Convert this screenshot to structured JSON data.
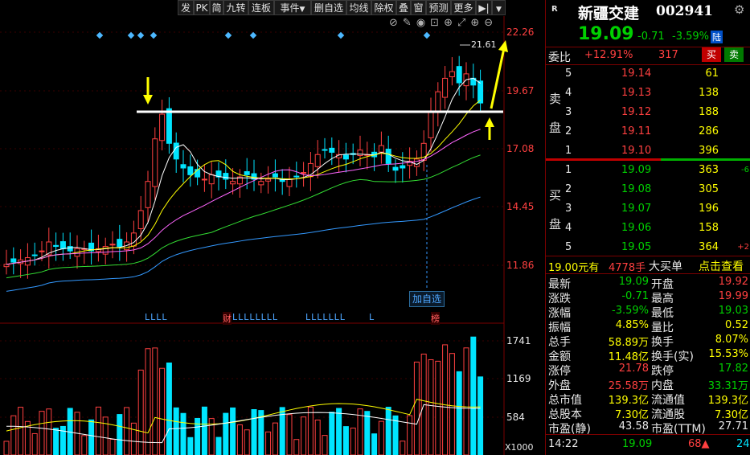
{
  "toolbar": {
    "buttons": [
      "发",
      "PK",
      "简",
      "九转",
      "连板",
      "事件",
      "删自选",
      "均线",
      "除权",
      "叠",
      "窗",
      "预测",
      "更多"
    ]
  },
  "chart": {
    "price_ticks": [
      "22.26",
      "19.67",
      "17.08",
      "14.45",
      "11.86"
    ],
    "volume_ticks": [
      "1741",
      "1169",
      "584",
      "X1000"
    ],
    "high_label": "21.61",
    "add_watch_label": "加自选",
    "badge_cai": "财",
    "badge_bang": "榜",
    "l_marks": "LLLL",
    "l_marks2": "LLLLLLLL",
    "l_marks3": "LLLLLLL",
    "l_marks4": "L"
  },
  "quote": {
    "name": "新疆交建",
    "code": "002941",
    "market_flag": "R",
    "price": "19.09",
    "change": "-0.71",
    "change_pct": "-3.59%",
    "exchange_tag": "陆",
    "weibi_label": "委比",
    "weibi_value": "+12.91%",
    "weicha": "317",
    "buy_btn": "买",
    "sell_btn": "卖",
    "sell_side_label": [
      "卖",
      "盘"
    ],
    "buy_side_label": [
      "买",
      "盘"
    ],
    "asks": [
      {
        "level": "5",
        "price": "19.14",
        "vol": "61"
      },
      {
        "level": "4",
        "price": "19.13",
        "vol": "138"
      },
      {
        "level": "3",
        "price": "19.12",
        "vol": "188"
      },
      {
        "level": "2",
        "price": "19.11",
        "vol": "286"
      },
      {
        "level": "1",
        "price": "19.10",
        "vol": "396"
      }
    ],
    "bids": [
      {
        "level": "1",
        "price": "19.09",
        "vol": "363",
        "chg": "-6"
      },
      {
        "level": "2",
        "price": "19.08",
        "vol": "305",
        "chg": ""
      },
      {
        "level": "3",
        "price": "19.07",
        "vol": "196",
        "chg": ""
      },
      {
        "level": "4",
        "price": "19.06",
        "vol": "158",
        "chg": ""
      },
      {
        "level": "5",
        "price": "19.05",
        "vol": "364",
        "chg": "+2"
      }
    ],
    "big_order": {
      "price_label": "19.00元有",
      "vol": "4778手",
      "text": "大买单",
      "link": "点击查看"
    },
    "stats": [
      {
        "l1": "最新",
        "v1": "19.09",
        "c1": "grn",
        "l2": "开盘",
        "v2": "19.92",
        "c2": "red"
      },
      {
        "l1": "涨跌",
        "v1": "-0.71",
        "c1": "grn",
        "l2": "最高",
        "v2": "19.99",
        "c2": "red"
      },
      {
        "l1": "涨幅",
        "v1": "-3.59%",
        "c1": "grn",
        "l2": "最低",
        "v2": "19.03",
        "c2": "grn"
      },
      {
        "l1": "振幅",
        "v1": "4.85%",
        "c1": "yel",
        "l2": "量比",
        "v2": "0.52",
        "c2": "yel"
      },
      {
        "l1": "总手",
        "v1": "58.89万",
        "c1": "yel",
        "l2": "换手",
        "v2": "8.07%",
        "c2": "yel"
      },
      {
        "l1": "金额",
        "v1": "11.48亿",
        "c1": "yel",
        "l2": "换手(实)",
        "v2": "15.53%",
        "c2": "yel"
      },
      {
        "l1": "涨停",
        "v1": "21.78",
        "c1": "red",
        "l2": "跌停",
        "v2": "17.82",
        "c2": "grn"
      },
      {
        "l1": "外盘",
        "v1": "25.58万",
        "c1": "red",
        "l2": "内盘",
        "v2": "33.31万",
        "c2": "grn"
      },
      {
        "l1": "总市值",
        "v1": "139.3亿",
        "c1": "yel",
        "l2": "流通值",
        "v2": "139.3亿",
        "c2": "yel"
      },
      {
        "l1": "总股本",
        "v1": "7.30亿",
        "c1": "yel",
        "l2": "流通股",
        "v2": "7.30亿",
        "c2": "yel"
      },
      {
        "l1": "市盈(静)",
        "v1": "43.58",
        "c1": "wht",
        "l2": "市盈(TTM)",
        "v2": "27.71",
        "c2": "wht"
      }
    ],
    "last_trade": {
      "time": "14:22",
      "price": "19.09",
      "vol": "68",
      "extra": "24"
    }
  }
}
